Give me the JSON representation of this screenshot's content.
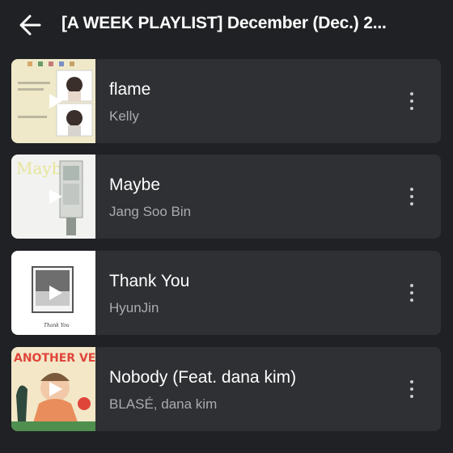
{
  "header": {
    "title": "[A WEEK PLAYLIST] December  (Dec.) 2...",
    "back_icon": "arrow-left-icon"
  },
  "songs": [
    {
      "title": "flame",
      "artist": "Kelly",
      "thumb_text": ""
    },
    {
      "title": "Maybe",
      "artist": "Jang Soo Bin",
      "thumb_text": "Maybe"
    },
    {
      "title": "Thank You",
      "artist": "HyunJin",
      "thumb_text": "Thank You"
    },
    {
      "title": "Nobody (Feat. dana kim)",
      "artist": "BLASÉ, dana kim",
      "thumb_text": "ANOTHER VER"
    }
  ],
  "icons": {
    "more": "more-vertical-icon",
    "play": "play-icon"
  },
  "colors": {
    "background": "#202124",
    "card": "#2e3033",
    "text_primary": "#ffffff",
    "text_secondary": "#a9abae"
  }
}
